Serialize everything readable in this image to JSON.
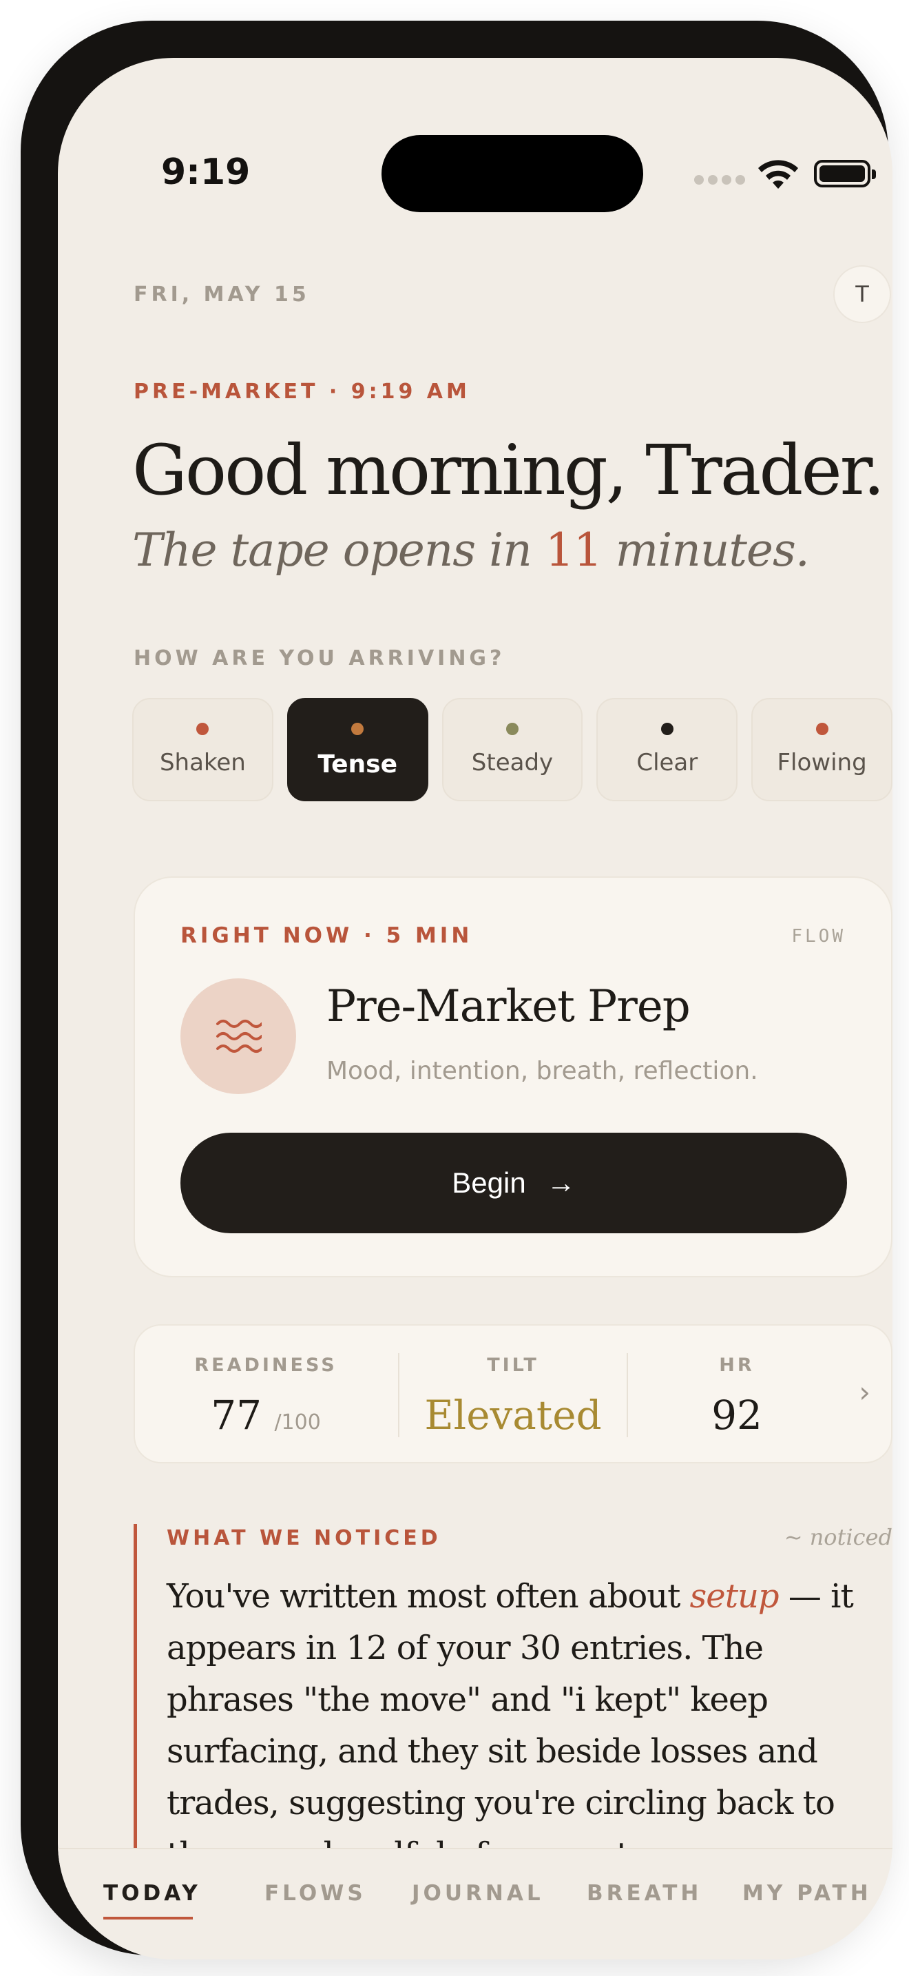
{
  "status_bar": {
    "time": "9:19"
  },
  "header": {
    "date": "FRI, MAY 15",
    "avatar_initial": "T",
    "session_label": "PRE-MARKET · 9:19 AM",
    "greeting": "Good morning, Trader.",
    "subline_prefix": "The tape opens in ",
    "subline_number": "11",
    "subline_suffix": " minutes."
  },
  "mood": {
    "question": "HOW ARE YOU ARRIVING?",
    "options": [
      {
        "label": "Shaken",
        "color": "#c0573c",
        "selected": false
      },
      {
        "label": "Tense",
        "color": "#c27a3e",
        "selected": true
      },
      {
        "label": "Steady",
        "color": "#8a8a5c",
        "selected": false
      },
      {
        "label": "Clear",
        "color": "#221e1a",
        "selected": false
      },
      {
        "label": "Flowing",
        "color": "#c0573c",
        "selected": false
      }
    ]
  },
  "right_now_card": {
    "eyebrow": "RIGHT NOW · 5 MIN",
    "tag": "FLOW",
    "icon": "waves-icon",
    "title": "Pre-Market Prep",
    "subtitle": "Mood, intention, breath, reflection.",
    "button_label": "Begin",
    "button_arrow": "→"
  },
  "stats": {
    "readiness": {
      "label": "READINESS",
      "value": "77",
      "suffix": "/100"
    },
    "tilt": {
      "label": "TILT",
      "value": "Elevated"
    },
    "hr": {
      "label": "HR",
      "value": "92"
    },
    "chevron": "›"
  },
  "noticed": {
    "title": "WHAT WE NOTICED",
    "tag": "~ noticed",
    "text_before": "You've written most often about ",
    "highlight": "setup",
    "text_after": " — it appears in 12 of your 30 entries. The phrases \"the move\" and \"i kept\" keep surfacing, and they sit beside losses and trades, suggesting you're circling back to the same handful of moments."
  },
  "tabs": [
    {
      "label": "TODAY",
      "active": true
    },
    {
      "label": "FLOWS",
      "active": false
    },
    {
      "label": "JOURNAL",
      "active": false
    },
    {
      "label": "BREATH",
      "active": false
    },
    {
      "label": "MY PATH",
      "active": false
    }
  ]
}
